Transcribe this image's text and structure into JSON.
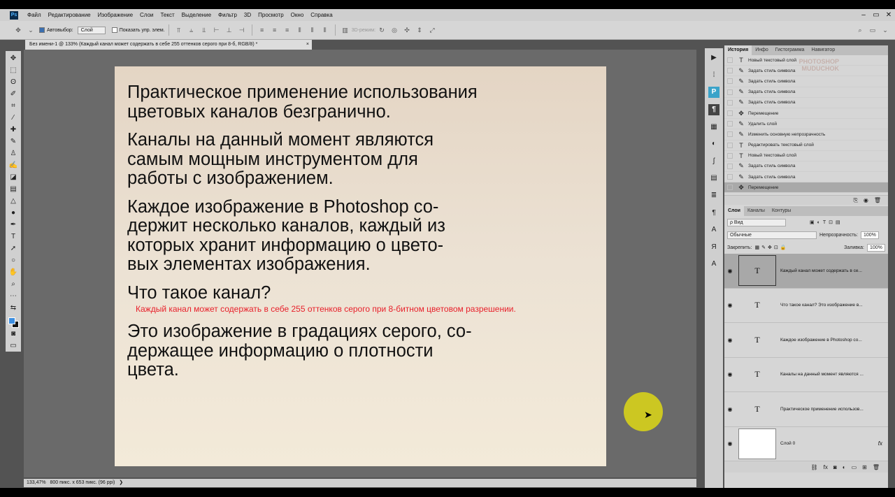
{
  "app": {
    "logo": "Ps",
    "menu": [
      "Файл",
      "Редактирование",
      "Изображение",
      "Слои",
      "Текст",
      "Выделение",
      "Фильтр",
      "3D",
      "Просмотр",
      "Окно",
      "Справка"
    ],
    "window_controls": [
      "–",
      "▭",
      "✕"
    ]
  },
  "options": {
    "autoselect_label": "Автовыбор:",
    "autoselect_value": "Слой",
    "show_transform_label": "Показать упр. элем.",
    "mode3d_label": "3D-режим:"
  },
  "document": {
    "tab_title": "Без имени-1 @ 133% (Каждый канал может содержать в себе 255 оттенков серого при 8-б, RGB/8) *",
    "tab_close": "×",
    "paragraphs": [
      "Практическое применение использования\nцветовых каналов безгранично.",
      "Каналы на данный момент являются\nсамым мощным инструментом для\nработы с изображением.",
      "Каждое изображение в Photoshop со-\nдержит несколько каналов, каждый из\nкоторых хранит информацию о цвето-\nвых элементах изображения.",
      "Что такое канал?"
    ],
    "red_line": "Каждый канал может содержать в себе 255 оттенков серого при 8-битном цветовом разрешении.",
    "last_paragraph": "Это изображение в градациях серого, со-\nдержащее информацию о плотности\nцвета."
  },
  "status": {
    "zoom": "133,47%",
    "doc_info": "800 пикс. x 653 пикс. (96 ppi)",
    "arrow": "❯"
  },
  "history_panel": {
    "tabs": [
      "История",
      "Инфо",
      "Гистограмма",
      "Навигатор"
    ],
    "items": [
      {
        "icon": "T",
        "label": "Новый текстовый слой"
      },
      {
        "icon": "✎",
        "label": "Задать стиль символа"
      },
      {
        "icon": "✎",
        "label": "Задать стиль символа"
      },
      {
        "icon": "✎",
        "label": "Задать стиль символа"
      },
      {
        "icon": "✎",
        "label": "Задать стиль символа"
      },
      {
        "icon": "✥",
        "label": "Перемещение"
      },
      {
        "icon": "✎",
        "label": "Удалить слой"
      },
      {
        "icon": "✎",
        "label": "Изменить основную непрозрачность"
      },
      {
        "icon": "T",
        "label": "Редактировать текстовый слой"
      },
      {
        "icon": "T",
        "label": "Новый текстовый слой"
      },
      {
        "icon": "✎",
        "label": "Задать стиль символа"
      },
      {
        "icon": "✎",
        "label": "Задать стиль символа"
      },
      {
        "icon": "✥",
        "label": "Перемещение"
      }
    ],
    "watermark": "PHOTOSHOP\nMUDUCHOK"
  },
  "layers_panel": {
    "tabs": [
      "Слои",
      "Каналы",
      "Контуры"
    ],
    "filter_label": "ρ Вид",
    "blend_mode": "Обычные",
    "opacity_label": "Непрозрачность:",
    "opacity_value": "100%",
    "lock_label": "Закрепить:",
    "fill_label": "Заливка:",
    "fill_value": "100%",
    "layers": [
      {
        "thumb": "T",
        "name": "Каждый канал может содержать в се...",
        "selected": true
      },
      {
        "thumb": "T",
        "name": "Что такое канал?  Это изображение в..."
      },
      {
        "thumb": "T",
        "name": "Каждое изображение в Photoshop со..."
      },
      {
        "thumb": "T",
        "name": "Каналы на данный момент являются ..."
      },
      {
        "thumb": "T",
        "name": "Практическое применение использов..."
      },
      {
        "thumb": "",
        "name": "Слой 0",
        "fx": "fx"
      }
    ]
  }
}
